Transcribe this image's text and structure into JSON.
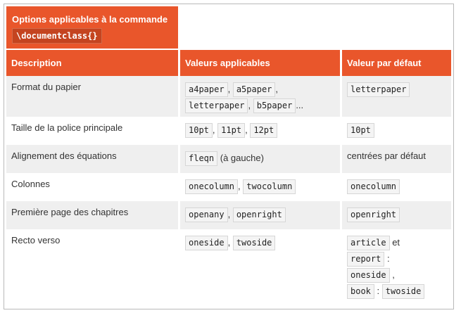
{
  "title": {
    "line1": "Options applicables à la commande",
    "command": "\\documentclass{}"
  },
  "headers": {
    "description": "Description",
    "values": "Valeurs applicables",
    "default": "Valeur par défaut"
  },
  "rows": {
    "r0": {
      "desc": "Format du papier",
      "v": [
        "a4paper",
        "a5paper",
        "letterpaper",
        "b5paper"
      ],
      "ellipsis": "...",
      "d": "letterpaper"
    },
    "r1": {
      "desc": "Taille de la police principale",
      "v": [
        "10pt",
        "11pt",
        "12pt"
      ],
      "d": "10pt"
    },
    "r2": {
      "desc": "Alignement des équations",
      "v": [
        "fleqn"
      ],
      "note": "(à gauche)",
      "d": "centrées par défaut"
    },
    "r3": {
      "desc": "Colonnes",
      "v": [
        "onecolumn",
        "twocolumn"
      ],
      "d": "onecolumn"
    },
    "r4": {
      "desc": "Première page des chapitres",
      "v": [
        "openany",
        "openright"
      ],
      "d": "openright"
    },
    "r5": {
      "desc": "Recto verso",
      "v": [
        "oneside",
        "twoside"
      ],
      "d": {
        "article": "article",
        "et": "et",
        "report": "report",
        "colon": ":",
        "oneside": "oneside",
        "comma": ",",
        "book": "book",
        "twoside": "twoside"
      }
    }
  },
  "punct": {
    "comma": ","
  }
}
